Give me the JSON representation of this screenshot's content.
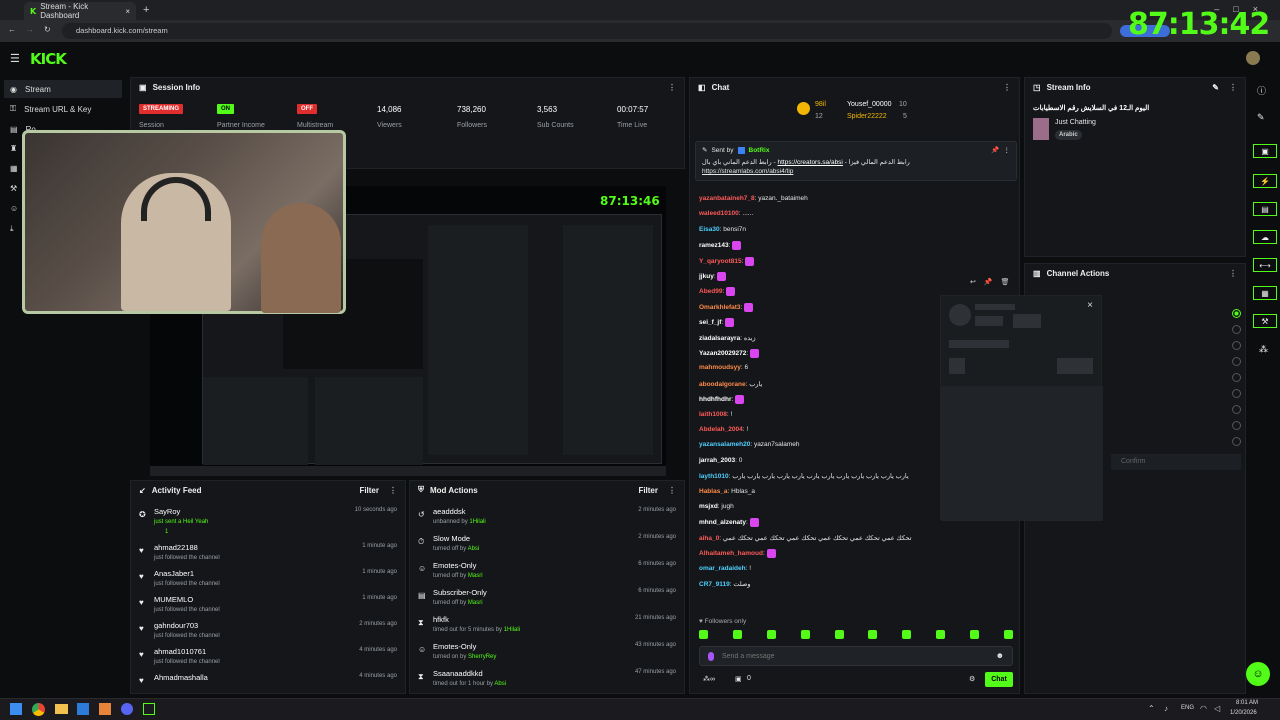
{
  "browser": {
    "tab_title": "Stream - Kick Dashboard",
    "new_tab": "+",
    "url": "dashboard.kick.com/stream",
    "timer_overlay": "87:13:42"
  },
  "topbar": {
    "logo": "KICK"
  },
  "sidebar": {
    "items": [
      {
        "label": "Stream",
        "icon": "stream-icon"
      },
      {
        "label": "Stream URL & Key",
        "icon": "key-icon"
      },
      {
        "label": "Ro",
        "icon": "roles-icon"
      }
    ]
  },
  "session": {
    "title": "Session Info",
    "badges": [
      "STREAMING",
      "ON",
      "OFF"
    ],
    "badge_labels": [
      "Session",
      "Partner Income",
      "Multistream"
    ],
    "stats": [
      {
        "value": "14,086",
        "label": "Viewers"
      },
      {
        "value": "738,260",
        "label": "Followers"
      },
      {
        "value": "3,563",
        "label": "Sub Counts"
      },
      {
        "value": "00:07:57",
        "label": "Time Live"
      }
    ],
    "preview_timer": "87:13:46"
  },
  "activity": {
    "title": "Activity Feed",
    "filter": "Filter",
    "items": [
      {
        "name": "SayRoy",
        "sub": "just sent a Heil Yeah",
        "time": "10 seconds ago",
        "count": "1"
      },
      {
        "name": "ahmad22188",
        "sub": "just followed the channel",
        "time": "1 minute ago"
      },
      {
        "name": "AnasJaber1",
        "sub": "just followed the channel",
        "time": "1 minute ago"
      },
      {
        "name": "MUMEMLO",
        "sub": "just followed the channel",
        "time": "1 minute ago"
      },
      {
        "name": "gahndour703",
        "sub": "just followed the channel",
        "time": "2 minutes ago"
      },
      {
        "name": "ahmad1010761",
        "sub": "just followed the channel",
        "time": "4 minutes ago"
      },
      {
        "name": "Ahmadmashalla",
        "sub": "",
        "time": "4 minutes ago"
      }
    ]
  },
  "mod": {
    "title": "Mod Actions",
    "filter": "Filter",
    "items": [
      {
        "name": "aeadddsk",
        "sub": "unbanned by",
        "by": "1Hilali",
        "time": "2 minutes ago"
      },
      {
        "name": "Slow Mode",
        "sub": "turned off by",
        "by": "Absi",
        "time": "2 minutes ago"
      },
      {
        "name": "Emotes-Only",
        "sub": "turned off by",
        "by": "Masri",
        "time": "6 minutes ago"
      },
      {
        "name": "Subscriber-Only",
        "sub": "turned off by",
        "by": "Masri",
        "time": "6 minutes ago"
      },
      {
        "name": "hfkfk",
        "sub": "timed out for 5 minutes by",
        "by": "1Hilali",
        "time": "21 minutes ago"
      },
      {
        "name": "Emotes-Only",
        "sub": "turned on by",
        "by": "SherryRey",
        "time": "43 minutes ago"
      },
      {
        "name": "Ssaanaaddkkd",
        "sub": "timed out for 1 hour by",
        "by": "Absi",
        "time": "47 minutes ago"
      }
    ]
  },
  "chat": {
    "title": "Chat",
    "leaders": [
      {
        "rank": "98il",
        "name": "Yousef_00000",
        "count": "10"
      },
      {
        "rank": "12",
        "name": "Spider22222",
        "count": "5"
      }
    ],
    "pinned": {
      "sent_by": "Sent by",
      "bot": "BotRix",
      "text": "رابط الدعم الماني باي بال - ",
      "link1": "https://creators.sa/absi",
      "link1_suffix": " - رابط الدعم المالي فيزا",
      "link2": "https://streamlabs.com/absi4/tip"
    },
    "messages": [
      {
        "user": "yazanbataineh7_8",
        "text": "yazan._bataimeh",
        "color": "#ff5a5a"
      },
      {
        "user": "waleed10100",
        "text": "......",
        "color": "#ff5a5a"
      },
      {
        "user": "Eisa30",
        "text": "bensi7n",
        "color": "#4fd1ff"
      },
      {
        "user": "ramez143",
        "text": "",
        "color": "#ffffff"
      },
      {
        "user": "Y_qaryoot815",
        "text": "",
        "color": "#ff5a5a"
      },
      {
        "user": "jjkuy",
        "text": "",
        "color": "#ffffff"
      },
      {
        "user": "Abed99",
        "text": "",
        "color": "#ff5a5a"
      },
      {
        "user": "Omarkhlefat3",
        "text": "",
        "color": "#ff8c4a"
      },
      {
        "user": "sei_f_jf",
        "text": "",
        "color": "#ffffff"
      },
      {
        "user": "ziadalsarayra",
        "text": "زيده",
        "color": "#ffffff"
      },
      {
        "user": "Yazan20029272",
        "text": "",
        "color": "#ffffff"
      },
      {
        "user": "mahmoudsyy",
        "text": "6",
        "color": "#ff8c4a"
      },
      {
        "user": "aboodalgorane",
        "text": "يارب",
        "color": "#ff8c4a"
      },
      {
        "user": "hhdhfhdhr",
        "text": "",
        "color": "#ffffff"
      },
      {
        "user": "laith1008",
        "text": "!",
        "color": "#ff5a5a"
      },
      {
        "user": "Abdelah_2004",
        "text": "!",
        "color": "#ff5a5a"
      },
      {
        "user": "yazansalameh20",
        "text": "yazan7salameh",
        "color": "#4fd1ff"
      },
      {
        "user": "jarrah_2003",
        "text": "0",
        "color": "#ffffff"
      },
      {
        "user": "layth1010",
        "text": "يارب يارب يارب يارب يارب يارب يارب يارب يارب يارب يارب يارب",
        "color": "#4fd1ff"
      },
      {
        "user": "Hablas_a",
        "text": "Hblas_a",
        "color": "#ff8c4a"
      },
      {
        "user": "msjxd",
        "text": "jugh",
        "color": "#ffffff"
      },
      {
        "user": "mhnd_alzenaty",
        "text": "",
        "color": "#ffffff"
      },
      {
        "user": "aiha_0",
        "text": "تحكك عمي تحكك عمي تحكك عمي تحكك عمي تحكك عمي تحكك عمي",
        "color": "#ff5a5a"
      },
      {
        "user": "Alhaitameh_hamoud",
        "text": "",
        "color": "#ff5a5a"
      },
      {
        "user": "omar_radaideh",
        "text": "!",
        "color": "#4fd1ff"
      },
      {
        "user": "CR7_9119",
        "text": "وصلت",
        "color": "#4fd1ff"
      }
    ],
    "followers_only": "Followers only",
    "placeholder": "Send a message",
    "send": "Chat",
    "bottom_count": "0"
  },
  "streaminfo": {
    "title": "Stream Info",
    "stream_title": "اليوم الـ12 في السلايش رقم الاسطيابات",
    "category": "Just Chatting",
    "tag": "Arabic"
  },
  "actions": {
    "title": "Channel Actions",
    "confirm": "Confirm"
  },
  "taskbar": {
    "lang": "ENG",
    "time": "8:01 AM",
    "date": "1/20/2026"
  },
  "colors": {
    "accent": "#53fc18",
    "bg": "#0b0d0f",
    "panel": "#141619"
  }
}
